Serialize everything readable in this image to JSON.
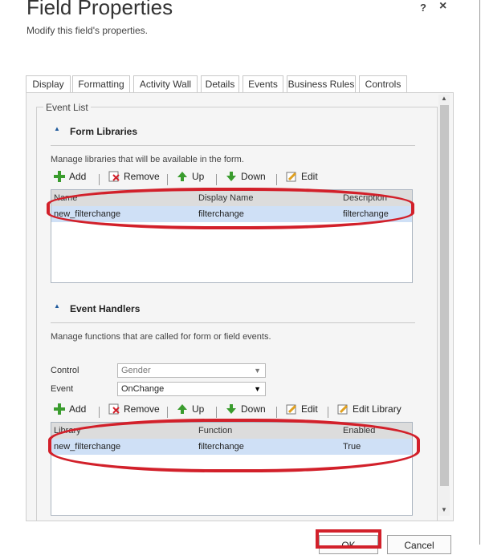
{
  "dialog": {
    "title": "Field Properties",
    "subtitle": "Modify this field's properties.",
    "help": "?",
    "close": "×"
  },
  "tabs": [
    {
      "label": "Display"
    },
    {
      "label": "Formatting"
    },
    {
      "label": "Activity Wall"
    },
    {
      "label": "Details"
    },
    {
      "label": "Events",
      "active": true
    },
    {
      "label": "Business Rules"
    },
    {
      "label": "Controls"
    }
  ],
  "event_list": {
    "legend": "Event List",
    "form_libraries": {
      "heading": "Form Libraries",
      "description": "Manage libraries that will be available in the form.",
      "toolbar": {
        "add": "Add",
        "remove": "Remove",
        "up": "Up",
        "down": "Down",
        "edit": "Edit"
      },
      "columns": [
        "Name",
        "Display Name",
        "Description"
      ],
      "rows": [
        {
          "name": "new_filterchange",
          "display_name": "filterchange",
          "description": "filterchange"
        }
      ]
    },
    "event_handlers": {
      "heading": "Event Handlers",
      "description": "Manage functions that are called for form or field events.",
      "control_label": "Control",
      "control_value": "Gender",
      "event_label": "Event",
      "event_value": "OnChange",
      "toolbar": {
        "add": "Add",
        "remove": "Remove",
        "up": "Up",
        "down": "Down",
        "edit": "Edit",
        "edit_library": "Edit Library"
      },
      "columns": [
        "Library",
        "Function",
        "Enabled"
      ],
      "rows": [
        {
          "library": "new_filterchange",
          "function": "filterchange",
          "enabled": "True"
        }
      ]
    }
  },
  "footer": {
    "ok": "OK",
    "cancel": "Cancel"
  },
  "colors": {
    "highlight": "#d2202a",
    "selected_row": "#cfe0f6",
    "accent": "#1f5a9c"
  }
}
